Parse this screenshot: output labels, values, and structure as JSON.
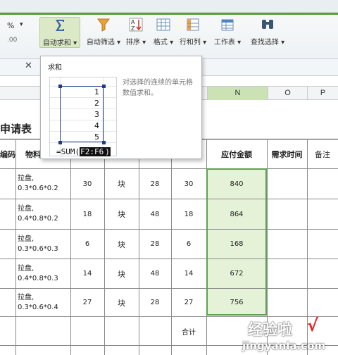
{
  "ribbon": {
    "buttons": [
      {
        "label": "自动求和",
        "icon": "sigma-icon"
      },
      {
        "label": "自动筛选",
        "icon": "filter-icon"
      },
      {
        "label": "排序",
        "icon": "sort-az-icon"
      },
      {
        "label": "格式",
        "icon": "format-grid-icon"
      },
      {
        "label": "行和列",
        "icon": "rows-columns-icon"
      },
      {
        "label": "工作表",
        "icon": "worksheet-icon"
      },
      {
        "label": "查找选择",
        "icon": "binoculars-icon"
      }
    ],
    "percent_glyph": "%",
    "accent_color": "#5a9e3a"
  },
  "tooltip": {
    "title": "求和",
    "description": "对选择的连续的单元格数值求和。",
    "preview_numbers": [
      "1",
      "2",
      "3",
      "4",
      "5"
    ],
    "formula_prefix": "=SUM(",
    "formula_range": "F2:F6",
    "formula_suffix": ")"
  },
  "columns": {
    "visible": [
      "N",
      "O",
      "P"
    ],
    "selected": "N"
  },
  "sheet": {
    "title_partial": "申请表",
    "headers": {
      "code_partial": "编码",
      "material": "物料",
      "amount": "应付金额",
      "need_time": "需求时间",
      "note": "备注"
    },
    "rows": [
      {
        "material": "拉盘,",
        "spec": "0.3*0.6*0.2",
        "qty": "30",
        "unit": "块",
        "price": "28",
        "qty2": "30",
        "amount": "840"
      },
      {
        "material": "拉盘,",
        "spec": "0.4*0.8*0.2",
        "qty": "18",
        "unit": "块",
        "price": "48",
        "qty2": "18",
        "amount": "864"
      },
      {
        "material": "拉盘,",
        "spec": "0.3*0.6*0.3",
        "qty": "6",
        "unit": "块",
        "price": "28",
        "qty2": "6",
        "amount": "168"
      },
      {
        "material": "拉盘,",
        "spec": "0.4*0.8*0.3",
        "qty": "14",
        "unit": "块",
        "price": "48",
        "qty2": "14",
        "amount": "672"
      },
      {
        "material": "拉盘,",
        "spec": "0.3*0.6*0.4",
        "qty": "27",
        "unit": "块",
        "price": "28",
        "qty2": "27",
        "amount": "756"
      }
    ],
    "total_label": "合计"
  },
  "watermark": {
    "text": "经验啦",
    "check": "√",
    "url": "jingyanla.com"
  }
}
